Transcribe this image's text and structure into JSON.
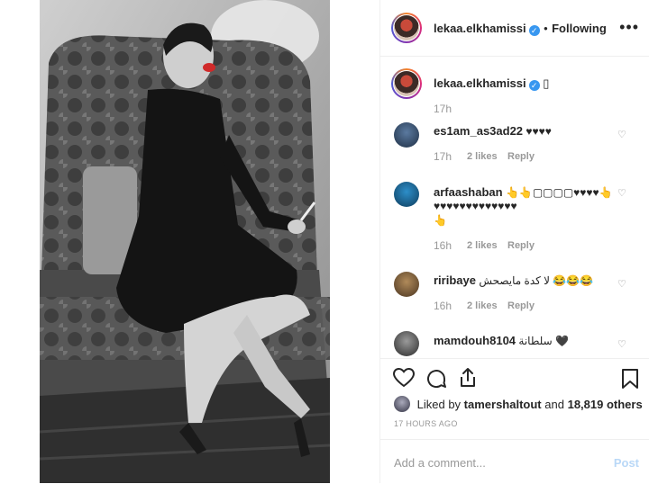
{
  "post": {
    "author": "lekaa.elkhamissi",
    "follow_status": "Following",
    "caption_emoji": "▯",
    "caption_time": "17h"
  },
  "comments": [
    {
      "user": "es1am_as3ad22",
      "text": "♥♥♥♥",
      "time": "17h",
      "likes": "2 likes",
      "reply": "Reply"
    },
    {
      "user": "arfaashaban",
      "text": "👆👆▢▢▢▢♥♥♥♥👆",
      "text2": "♥♥♥♥♥♥♥♥♥♥♥♥♥",
      "text3": "👆",
      "time": "16h",
      "likes": "2 likes",
      "reply": "Reply"
    },
    {
      "user": "riribaye",
      "text": "لا كدة مايصحش 😂😂😂",
      "time": "16h",
      "likes": "2 likes",
      "reply": "Reply"
    },
    {
      "user": "mamdouh8104",
      "text": "سلطانة 🖤",
      "time": "",
      "likes": "",
      "reply": ""
    }
  ],
  "likes": {
    "prefix": "Liked by",
    "user": "tamershaltout",
    "and": "and",
    "count": "18,819 others"
  },
  "time_ago": "17 HOURS AGO",
  "composer": {
    "placeholder": "Add a comment...",
    "post_label": "Post"
  },
  "icons": {
    "more": "more-options-icon",
    "like": "heart-icon",
    "comment": "comment-icon",
    "share": "share-icon",
    "save": "bookmark-icon"
  }
}
